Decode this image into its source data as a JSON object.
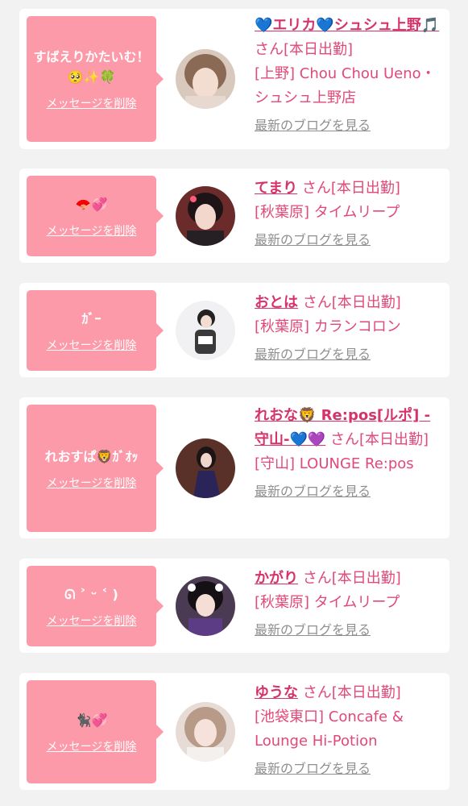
{
  "delete_label": "メッセージを削除",
  "blog_label": "最新のブログを見る",
  "san_label": "さん",
  "items": [
    {
      "message": "すばえりかたいむ！🥺✨🍀",
      "name": "💙エリカ💙シュシュ上野🎵",
      "status": "[本日出勤]",
      "shop": "[上野] Chou Chou Ueno・シュシュ上野店"
    },
    {
      "message": "🪭💞",
      "name": "てまり",
      "status": "[本日出勤]",
      "shop": "[秋葉原] タイムリープ"
    },
    {
      "message": "ｶﾞｰ",
      "name": "おとは",
      "status": "[本日出勤]",
      "shop": "[秋葉原] カランコロン"
    },
    {
      "message": "れおすぱ🦁ｶﾞｵｯ",
      "name": "れおな🦁 Re:pos[ルポ] -守山-💙💜",
      "status": "[本日出勤]",
      "shop": "[守山] LOUNGE Re:pos"
    },
    {
      "message": "ᘏ ˃ ᵕ ˂ )",
      "name": "かがり",
      "status": "[本日出勤]",
      "shop": "[秋葉原] タイムリープ"
    },
    {
      "message": "🐈‍⬛💞",
      "name": "ゆうな",
      "status": "[本日出勤]",
      "shop": "[池袋東口] Concafe & Lounge Hi-Potion"
    }
  ],
  "colors": {
    "bubble": "#fd9aa9",
    "accent": "#d6336c",
    "link_gray": "#8f8f8f"
  }
}
